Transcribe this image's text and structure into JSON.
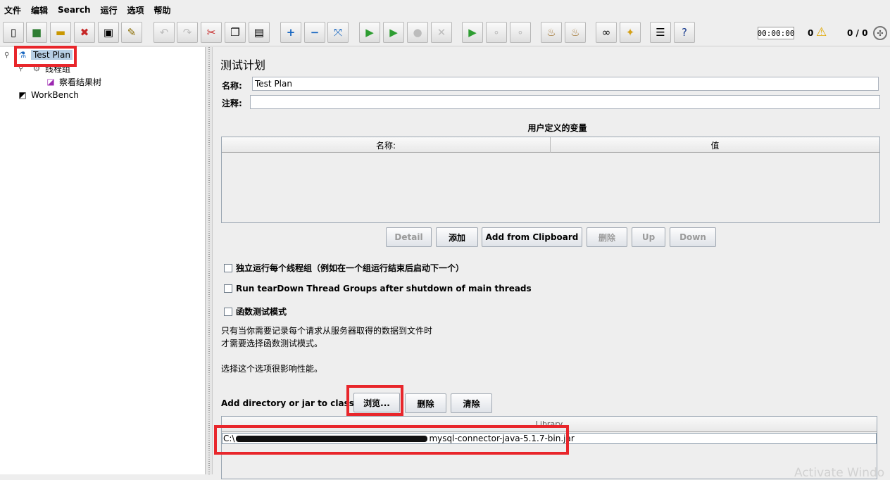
{
  "menu": [
    "文件",
    "编辑",
    "Search",
    "运行",
    "选项",
    "帮助"
  ],
  "toolbar": {
    "icons": [
      "new-icon",
      "templates-icon",
      "open-icon",
      "close-icon",
      "save-icon",
      "save-as-icon",
      "undo-icon",
      "redo-icon",
      "cut-icon",
      "copy-icon",
      "paste-icon",
      "expand-icon",
      "collapse-icon",
      "toggle-icon",
      "start-icon",
      "start-no-pause-icon",
      "stop-icon",
      "shutdown-icon",
      "remote-start-icon",
      "remote-stop-icon",
      "remote-shutdown-icon",
      "clear-icon",
      "clear-all-icon",
      "search-icon",
      "reset-search-icon",
      "function-helper-icon",
      "help-icon"
    ],
    "timer": "00:00:00",
    "warnings": "0",
    "threads": "0 / 0"
  },
  "tree": {
    "items": [
      {
        "label": "Test Plan",
        "icon": "test-plan-icon"
      },
      {
        "label": "线程组",
        "icon": "thread-group-icon"
      },
      {
        "label": "察看结果树",
        "icon": "results-tree-icon"
      },
      {
        "label": "WorkBench",
        "icon": "workbench-icon"
      }
    ]
  },
  "panel": {
    "title": "测试计划",
    "name_label": "名称:",
    "name_value": "Test Plan",
    "comment_label": "注释:",
    "comment_value": "",
    "vars_title": "用户定义的变量",
    "vars_columns": [
      "名称:",
      "值"
    ],
    "buttons": {
      "detail": "Detail",
      "add": "添加",
      "add_clipboard": "Add from Clipboard",
      "delete": "删除",
      "up": "Up",
      "down": "Down"
    },
    "checkboxes": [
      "独立运行每个线程组（例如在一个组运行结束后启动下一个）",
      "Run tearDown Thread Groups after shutdown of main threads",
      "函数测试模式"
    ],
    "info_line1": "只有当你需要记录每个请求从服务器取得的数据到文件时",
    "info_line2": "才需要选择函数测试模式。",
    "info_line3": "选择这个选项很影响性能。",
    "classpath_label": "Add directory or jar to classpath",
    "browse": "浏览...",
    "cp_delete": "删除",
    "cp_clear": "清除",
    "lib_header": "Library",
    "lib_row_prefix": "C:\\",
    "lib_row_suffix": "mysql-connector-java-5.1.7-bin.jar"
  },
  "watermark": "Activate Windo"
}
